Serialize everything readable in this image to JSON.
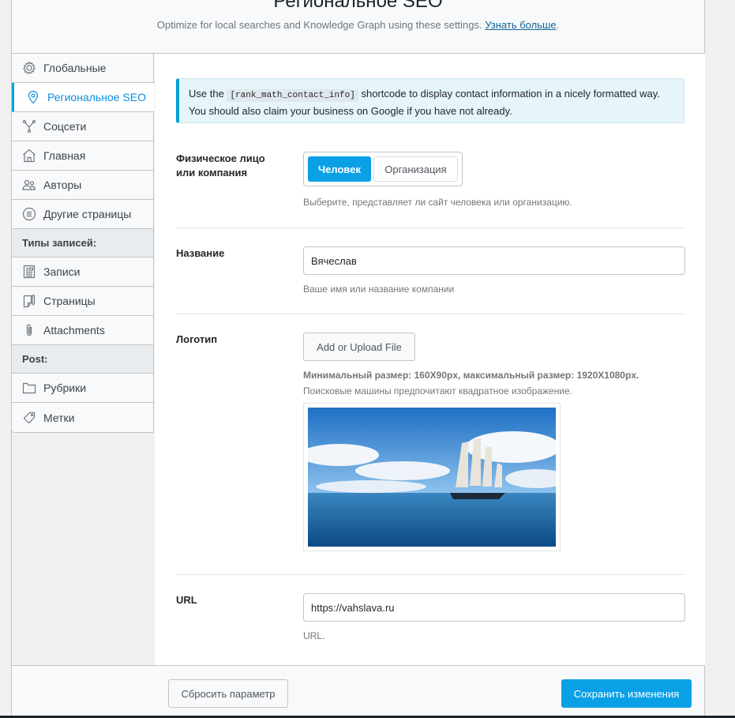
{
  "header": {
    "title": "Региональное SEO",
    "subtitle": "Optimize for local searches and Knowledge Graph using these settings.",
    "learn_more": "Узнать больше",
    "period": "."
  },
  "sidebar": {
    "items": [
      {
        "label": "Глобальные",
        "icon": "gear-icon"
      },
      {
        "label": "Региональное SEO",
        "icon": "map-pin-icon",
        "active": true
      },
      {
        "label": "Соцсети",
        "icon": "share-nodes-icon"
      },
      {
        "label": "Главная",
        "icon": "home-icon"
      },
      {
        "label": "Авторы",
        "icon": "users-icon"
      },
      {
        "label": "Другие страницы",
        "icon": "list-circle-icon"
      }
    ],
    "group1": "Типы записей:",
    "group1_items": [
      {
        "label": "Записи",
        "icon": "post-icon"
      },
      {
        "label": "Страницы",
        "icon": "page-icon"
      },
      {
        "label": "Attachments",
        "icon": "paperclip-icon"
      }
    ],
    "group2": "Post:",
    "group2_items": [
      {
        "label": "Рубрики",
        "icon": "folder-icon"
      },
      {
        "label": "Метки",
        "icon": "tag-icon"
      }
    ]
  },
  "notice": {
    "before": "Use the",
    "code": "[rank_math_contact_info]",
    "after": "shortcode to display contact information in a nicely formatted way. You should also claim your business on Google if you have not already."
  },
  "entity": {
    "label": "Физическое лицо или компания",
    "options": [
      "Человек",
      "Организация"
    ],
    "selected": "Человек",
    "desc": "Выберите, представляет ли сайт человека или организацию."
  },
  "name": {
    "label": "Название",
    "value": "Вячеслав",
    "desc": "Ваше имя или название компании"
  },
  "logo": {
    "label": "Логотип",
    "button": "Add or Upload File",
    "size_note": "Минимальный размер: 160X90px, максимальный размер: 1920X1080px.",
    "hint": "Поисковые машины предпочитают квадратное изображение."
  },
  "url": {
    "label": "URL",
    "value": "https://vahslava.ru",
    "desc": "URL."
  },
  "footer": {
    "reset": "Сбросить параметр",
    "save": "Сохранить изменения"
  },
  "colors": {
    "accent": "#0aa0e6",
    "link": "#10649b"
  }
}
